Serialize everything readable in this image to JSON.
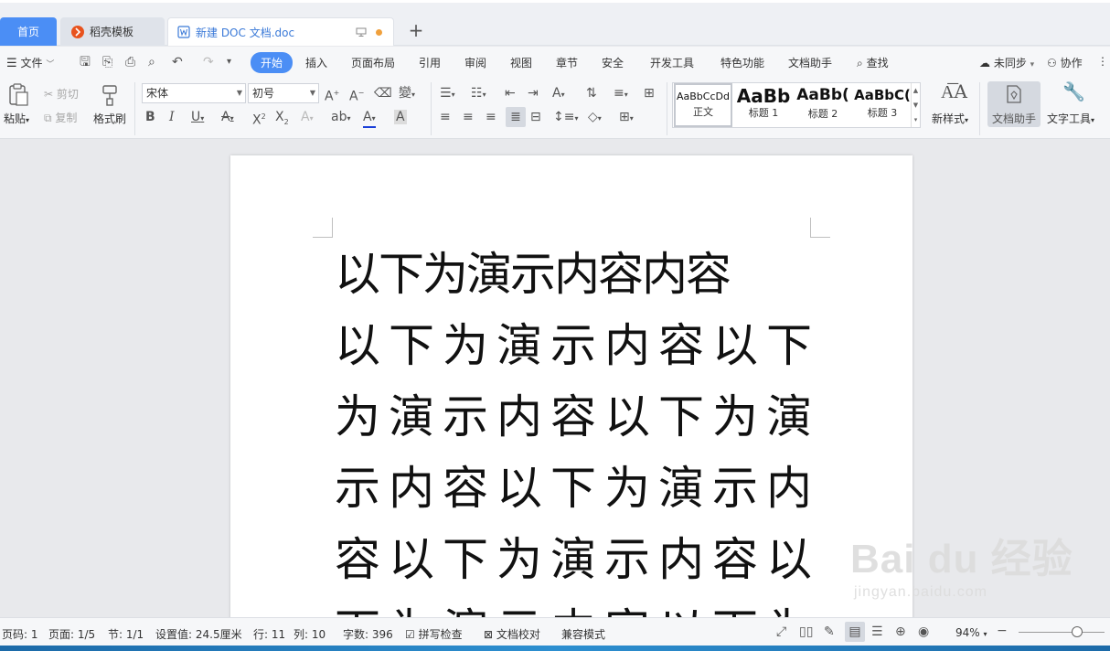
{
  "tabs": {
    "home": "首页",
    "template": "稻壳模板",
    "document": "新建 DOC 文档.doc",
    "add": "+"
  },
  "menu": {
    "file": "文件",
    "items": [
      "开始",
      "插入",
      "页面布局",
      "引用",
      "审阅",
      "视图",
      "章节",
      "安全",
      "开发工具",
      "特色功能",
      "文档助手"
    ],
    "search": "查找",
    "sync": "未同步",
    "collab": "协作"
  },
  "ribbon": {
    "paste": "粘贴",
    "cut": "剪切",
    "copy": "复制",
    "format_painter": "格式刷",
    "font_name": "宋体",
    "font_size": "初号",
    "styles": [
      {
        "sample": "AaBbCcDd",
        "name": "正文"
      },
      {
        "sample": "AaBb",
        "name": "标题 1"
      },
      {
        "sample": "AaBb(",
        "name": "标题 2"
      },
      {
        "sample": "AaBbC(",
        "name": "标题 3"
      }
    ],
    "new_style": "新样式",
    "doc_helper": "文档助手",
    "text_tools": "文字工具"
  },
  "document": {
    "lines": [
      "以下为演示内容内容",
      "以下为演示内容以下",
      "为演示内容以下为演",
      "示内容以下为演示内",
      "容以下为演示内容以",
      "下为演示内容以下为"
    ]
  },
  "watermark": {
    "brand": "Bai du 经验",
    "url": "jingyan.baidu.com"
  },
  "status": {
    "page_code": "页码: 1",
    "page": "页面: 1/5",
    "section": "节: 1/1",
    "setting": "设置值: 24.5厘米",
    "row": "行: 11",
    "col": "列: 10",
    "words": "字数: 396",
    "spell_check": "拼写检查",
    "proof": "文档校对",
    "compat": "兼容模式",
    "zoom": "94%",
    "zoom_level": 94
  },
  "colors": {
    "accent": "#4b8ef5",
    "doc_tab_text": "#3b7ad8",
    "modified_dot": "#f0a03c",
    "font_color_underline": "#1a3fd8",
    "wps_logo": "#e8531e"
  }
}
